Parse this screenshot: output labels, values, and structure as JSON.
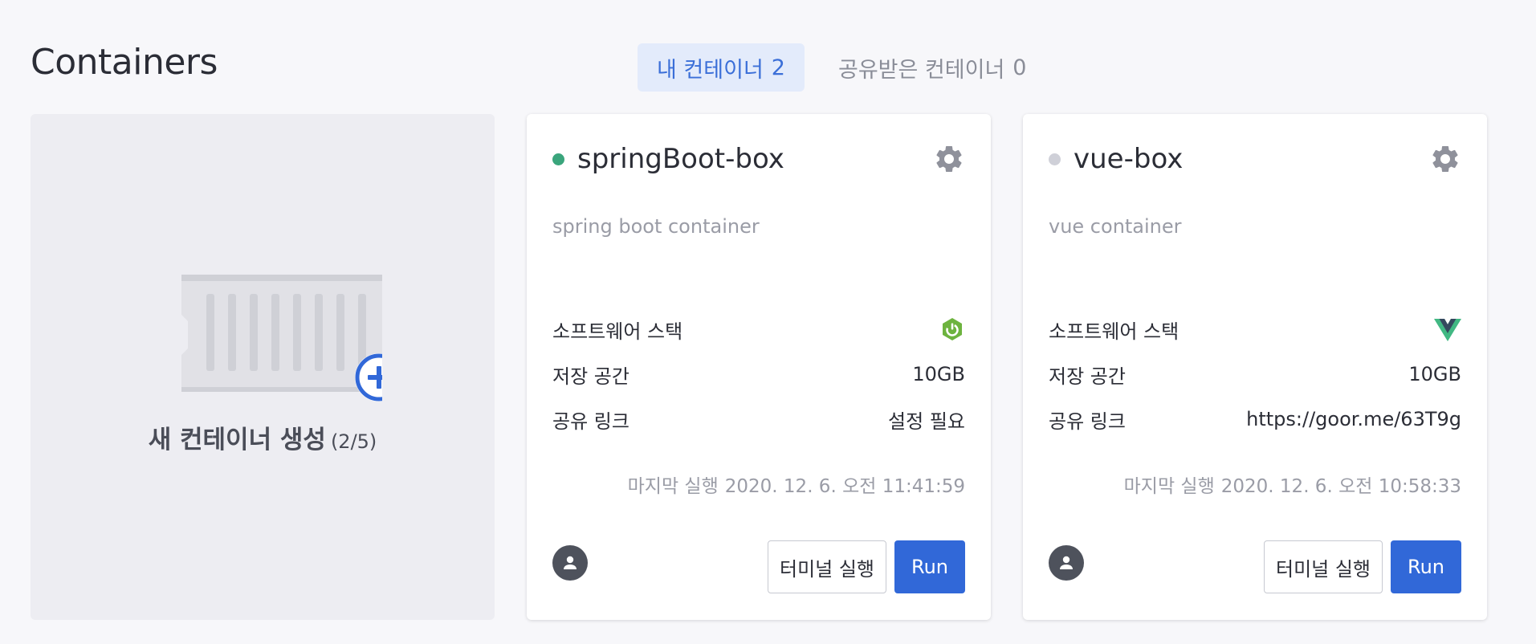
{
  "page": {
    "title": "Containers"
  },
  "tabs": [
    {
      "label": "내 컨테이너",
      "count": "2"
    },
    {
      "label": "공유받은 컨테이너",
      "count": "0"
    }
  ],
  "new_container": {
    "label": "새 컨테이너 생성",
    "quota": "(2/5)"
  },
  "colors": {
    "accent": "#3168d8",
    "status_running": "#3aa57c",
    "status_stopped": "#cfd0d8"
  },
  "containers": [
    {
      "name": "springBoot-box",
      "description": "spring boot container",
      "status": "running",
      "stack_icon": "spring-boot-icon",
      "labels": {
        "stack": "소프트웨어 스택",
        "storage": "저장 공간",
        "share": "공유 링크"
      },
      "storage": "10GB",
      "share_link": "설정 필요",
      "last_run_label": "마지막 실행",
      "last_run": "2020. 12. 6. 오전 11:41:59",
      "terminal_label": "터미널 실행",
      "run_label": "Run"
    },
    {
      "name": "vue-box",
      "description": "vue container",
      "status": "stopped",
      "stack_icon": "vue-icon",
      "labels": {
        "stack": "소프트웨어 스택",
        "storage": "저장 공간",
        "share": "공유 링크"
      },
      "storage": "10GB",
      "share_link": "https://goor.me/63T9g",
      "last_run_label": "마지막 실행",
      "last_run": "2020. 12. 6. 오전 10:58:33",
      "terminal_label": "터미널 실행",
      "run_label": "Run"
    }
  ]
}
